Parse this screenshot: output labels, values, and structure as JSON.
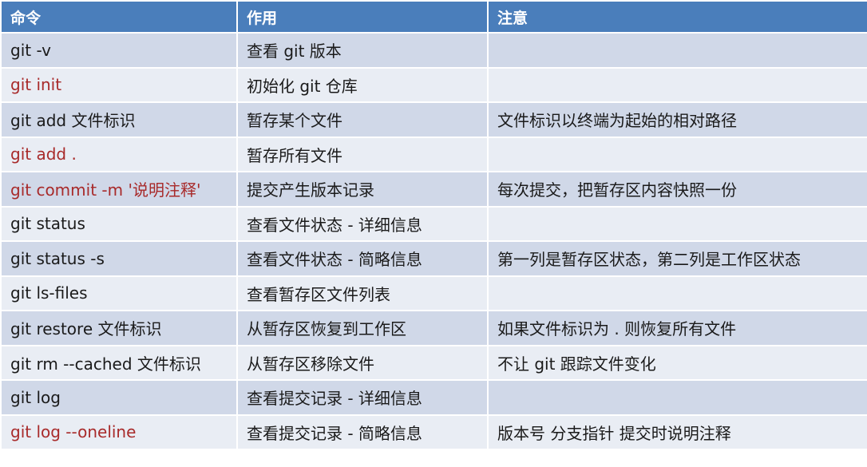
{
  "colors": {
    "header_bg": "#4a7ebb",
    "row_odd": "#d0d8e8",
    "row_even": "#e9edf4",
    "highlight_text": "#a82a2a"
  },
  "table": {
    "headers": [
      "命令",
      "作用",
      "注意"
    ],
    "rows": [
      {
        "command": "git -v",
        "purpose": "查看 git 版本",
        "note": "",
        "highlight": false
      },
      {
        "command": "git init",
        "purpose": "初始化 git 仓库",
        "note": "",
        "highlight": true
      },
      {
        "command": "git add 文件标识",
        "purpose": "暂存某个文件",
        "note": "文件标识以终端为起始的相对路径",
        "highlight": false
      },
      {
        "command": "git add .",
        "purpose": "暂存所有文件",
        "note": "",
        "highlight": true
      },
      {
        "command": "git commit -m '说明注释'",
        "purpose": "提交产生版本记录",
        "note": "每次提交，把暂存区内容快照一份",
        "highlight": true
      },
      {
        "command": "git status",
        "purpose": "查看文件状态 - 详细信息",
        "note": "",
        "highlight": false
      },
      {
        "command": "git status -s",
        "purpose": "查看文件状态 - 简略信息",
        "note": "第一列是暂存区状态，第二列是工作区状态",
        "highlight": false
      },
      {
        "command": "git ls-files",
        "purpose": "查看暂存区文件列表",
        "note": "",
        "highlight": false
      },
      {
        "command": "git restore 文件标识",
        "purpose": "从暂存区恢复到工作区",
        "note": "如果文件标识为 . 则恢复所有文件",
        "highlight": false
      },
      {
        "command": "git rm --cached 文件标识",
        "purpose": "从暂存区移除文件",
        "note": "不让 git 跟踪文件变化",
        "highlight": false
      },
      {
        "command": "git log",
        "purpose": "查看提交记录 - 详细信息",
        "note": "",
        "highlight": false
      },
      {
        "command": "git log --oneline",
        "purpose": "查看提交记录 - 简略信息",
        "note": "版本号 分支指针 提交时说明注释",
        "highlight": true
      }
    ]
  }
}
